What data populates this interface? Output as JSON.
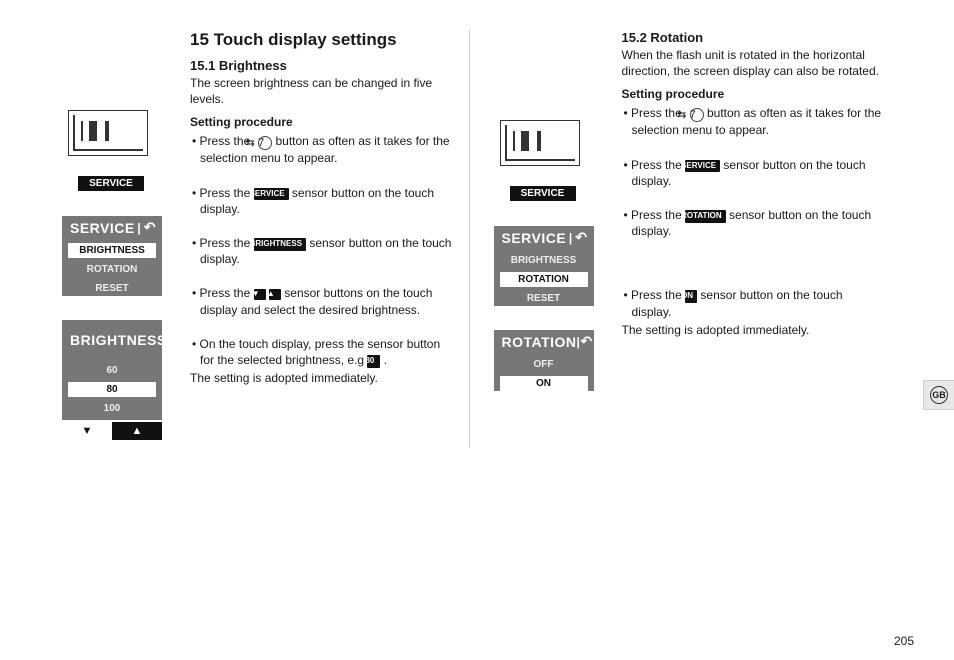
{
  "title": "15 Touch display settings",
  "brightness": {
    "heading": "15.1 Brightness",
    "intro": "The screen brightness can be changed in five levels.",
    "procLabel": "Setting procedure",
    "step1_a": "Press the ",
    "step1_b": " button as often as it takes for the selection menu to appear.",
    "step2_a": "Press the ",
    "step2_b": " sensor button on the touch display.",
    "step3_a": "Press the ",
    "step3_b": " sensor button on the touch display.",
    "step4_a": "Press the ",
    "step4_b": " sensor buttons on the touch display and select the desired brightness.",
    "step5_a": "On the touch display, press the sensor button for the selected brightness, e.g ",
    "step5_b": " .",
    "closing": "The setting is adopted immediately.",
    "chip_service": "SERVICE",
    "chip_brightness": "BRIGHTNESS",
    "chip_80": "80",
    "circ7": "7",
    "panel_service": {
      "title": "SERVICE",
      "items": [
        "BRIGHTNESS",
        "ROTATION",
        "RESET"
      ]
    },
    "panel_brightness": {
      "title": "BRIGHTNESS",
      "items": [
        "60",
        "80",
        "100"
      ]
    }
  },
  "rotation": {
    "heading": "15.2 Rotation",
    "intro": "When the flash unit is rotated in the horizontal direction, the screen display can also be rotated.",
    "procLabel": "Setting procedure",
    "step1_a": "Press the ",
    "step1_b": " button as often as it takes for the selection menu to appear.",
    "step2_a": "Press the ",
    "step2_b": " sensor button on the touch display.",
    "step3_a": "Press the ",
    "step3_b": " sensor button on the touch display.",
    "step4_a": "Press the ",
    "step4_b": " sensor button on the touch display.",
    "closing": "The setting is adopted immediately.",
    "chip_service": "SERVICE",
    "chip_rotation": "ROTATION",
    "chip_on": "ON",
    "circ7": "7",
    "panel_service": {
      "title": "SERVICE",
      "items": [
        "BRIGHTNESS",
        "ROTATION",
        "RESET"
      ]
    },
    "panel_rotation": {
      "title": "ROTATION",
      "items": [
        "OFF",
        "ON"
      ]
    }
  },
  "pageNumber": "205",
  "langTab": "GB"
}
